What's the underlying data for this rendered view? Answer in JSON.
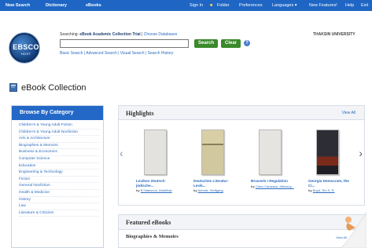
{
  "topbar": {
    "items": [
      "New Search",
      "Dictionary",
      "eBooks"
    ],
    "sign_in": "Sign In",
    "folder": "Folder",
    "preferences": "Preferences",
    "languages": "Languages ▾",
    "new_features": "New Features!",
    "help": "Help",
    "exit": "Exit"
  },
  "logo": {
    "main": "EBSCO",
    "sub": "HOST"
  },
  "search": {
    "searching_label": "Searching:",
    "database": "eBook Academic Collection Trial",
    "choose_db": "Choose Databases",
    "placeholder": "",
    "search_btn": "Search",
    "clear_btn": "Clear",
    "help_icon": "?",
    "links": "Basic Search  |  Advanced Search  |  Visual Search  |  Search History"
  },
  "institution": "THAKSIN UNIVERSITY",
  "page_title": "eBook Collection",
  "sidebar": {
    "title": "Browse By Category",
    "items": [
      "Children's & Young Adult Fiction",
      "Children's & Young Adult Nonfiction",
      "Arts & Architecture",
      "Biographies & Memoirs",
      "Business & Economics",
      "Computer Science",
      "Education",
      "Engineering & Technology",
      "Fiction",
      "General Nonfiction",
      "Health & Medicine",
      "History",
      "Law",
      "Literature & Criticism"
    ]
  },
  "highlights": {
    "title": "Highlights",
    "view_all": "View All",
    "books": [
      {
        "title": "Lexikon deutsch-jüdische...",
        "by": "by",
        "author": "El Mansouri, Abdelhak",
        "cover_color": "#e4e2de"
      },
      {
        "title": "Deutsches Literatur-Lexik...",
        "by": "by",
        "author": "Achnitz, Wolfgang",
        "cover_color": "#cfc7a3"
      },
      {
        "title": "Brussels I Regulation",
        "by": "by",
        "author": "Calvo Caravaca, Alfonsoy...",
        "cover_color": "#e4e2de"
      },
      {
        "title": "Georgia Democrats, the Ci...",
        "by": "by",
        "author": "Boyd, Tim S. R.",
        "cover_color": "#3a2a2a"
      }
    ]
  },
  "featured": {
    "title": "Featured eBooks",
    "category": "Biographies & Memoirs",
    "view_all": "View All"
  }
}
